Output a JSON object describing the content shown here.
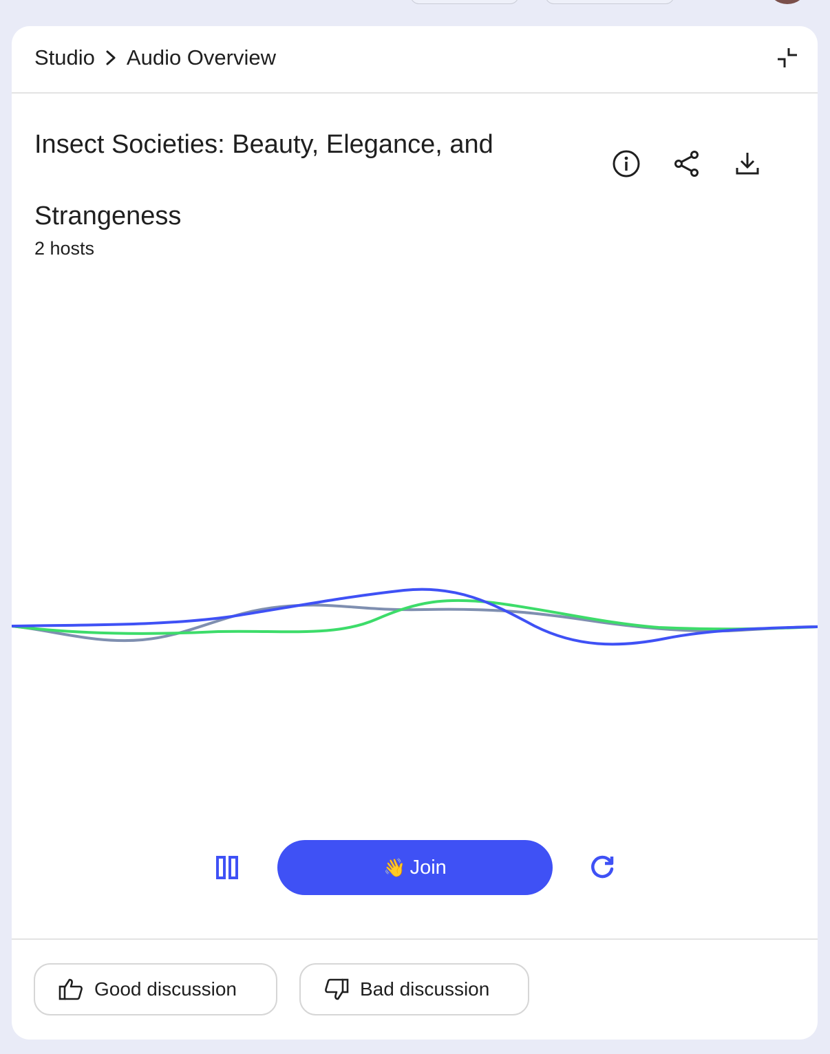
{
  "breadcrumb": {
    "root": "Studio",
    "current": "Audio Overview"
  },
  "overview": {
    "title_line1": "Insect Societies: Beauty, Elegance, and",
    "title_line2": "Strangeness",
    "hosts": "2 hosts"
  },
  "actions": {
    "info_icon": "info-icon",
    "share_icon": "share-icon",
    "download_icon": "download-icon",
    "collapse_icon": "collapse-icon"
  },
  "player": {
    "join_emoji": "👋",
    "join_label": "Join",
    "pause_icon": "pause-icon",
    "replay_icon": "replay-icon"
  },
  "feedback": {
    "good_label": "Good discussion",
    "bad_label": "Bad discussion"
  },
  "colors": {
    "accent": "#3f51f5",
    "wave_blue": "#3f51f5",
    "wave_green": "#3ddc6a",
    "wave_grey": "#7f8fb0",
    "background": "#e9ebf7"
  }
}
